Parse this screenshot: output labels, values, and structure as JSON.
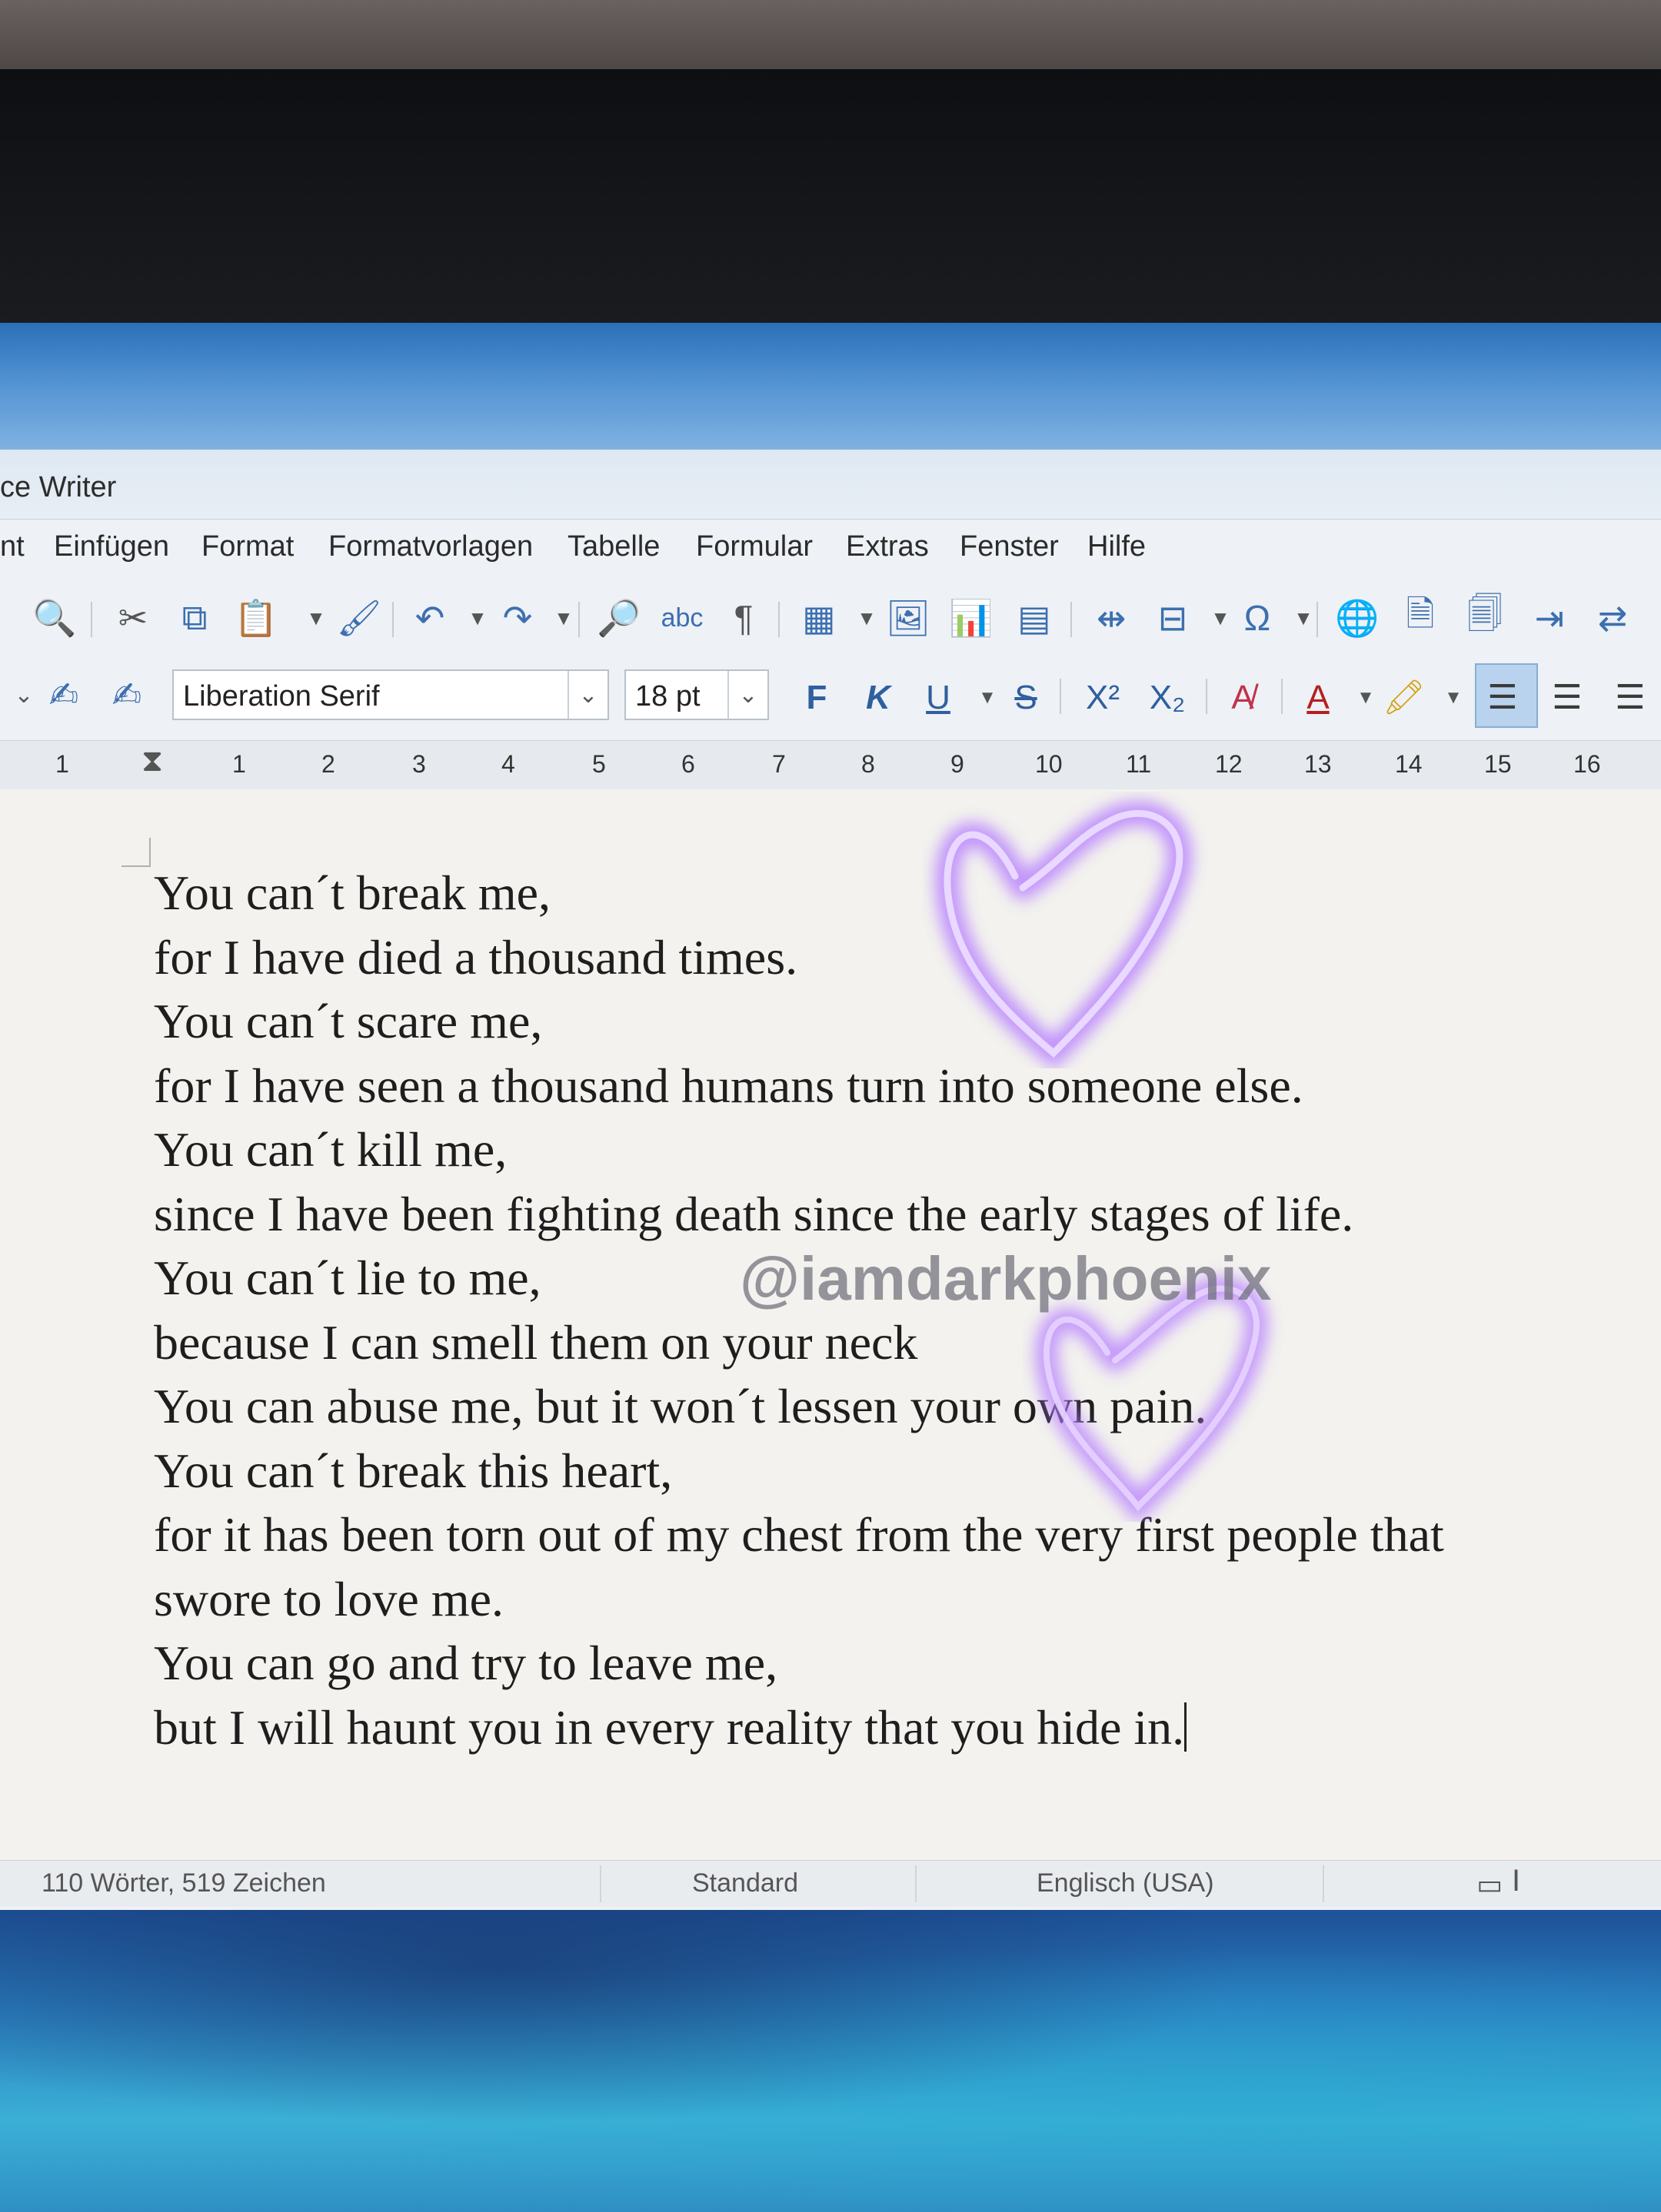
{
  "window": {
    "title": "ce Writer"
  },
  "menu": [
    "nt",
    "Einfügen",
    "Format",
    "Formatvorlagen",
    "Tabelle",
    "Formular",
    "Extras",
    "Fenster",
    "Hilfe"
  ],
  "toolbar": {
    "font_name": "Liberation Serif",
    "font_size": "18 pt",
    "bold_label": "F",
    "italic_label": "K",
    "underline_label": "U",
    "strike_label": "S",
    "superscript_label": "X²",
    "subscript_label": "X₂"
  },
  "ruler": [
    "1",
    "1",
    "2",
    "3",
    "4",
    "5",
    "6",
    "7",
    "8",
    "9",
    "10",
    "11",
    "12",
    "13",
    "14",
    "15",
    "16"
  ],
  "document": {
    "lines": [
      "You can´t break me,",
      "for I have died a thousand times.",
      "You can´t scare me,",
      "for I have seen a thousand humans turn into someone else.",
      "You can´t kill me,",
      "since I have been fighting death since the early stages of life.",
      "You can´t lie to me,",
      "because I can smell them on your neck",
      "You can abuse me, but it won´t lessen your own pain.",
      "You can´t break this heart,",
      "for it has been torn out of my chest from the very first people that",
      "swore to love me.",
      "You can go and try to leave me,",
      "but I will haunt you in every reality that you hide in."
    ]
  },
  "overlay": {
    "watermark": "@iamdarkphoenix",
    "heart_color": "#b57cff"
  },
  "status": {
    "word_count": "110 Wörter, 519 Zeichen",
    "page_style": "Standard",
    "language": "Englisch (USA)"
  }
}
